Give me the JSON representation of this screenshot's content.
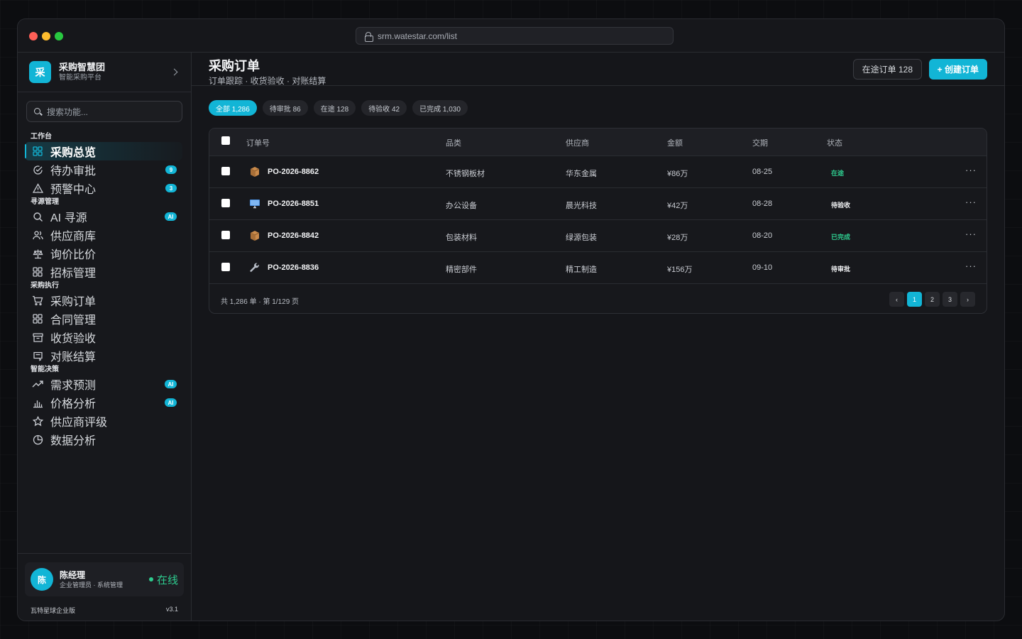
{
  "browser": {
    "url": "srm.watestar.com/list"
  },
  "brand": {
    "logo_char": "采",
    "name": "采购智慧团",
    "subtitle": "智能采购平台"
  },
  "search": {
    "placeholder": "搜索功能..."
  },
  "nav": {
    "groups": [
      {
        "label": "工作台",
        "items": [
          {
            "label": "采购总览",
            "icon": "grid-icon",
            "active": true
          },
          {
            "label": "待办审批",
            "icon": "check-circle-icon",
            "badge": "9"
          },
          {
            "label": "预警中心",
            "icon": "alert-triangle-icon",
            "badge": "3"
          }
        ]
      },
      {
        "label": "寻源管理",
        "items": [
          {
            "label": "AI 寻源",
            "icon": "search-icon",
            "badge": "AI"
          },
          {
            "label": "供应商库",
            "icon": "users-icon"
          },
          {
            "label": "询价比价",
            "icon": "scale-icon"
          },
          {
            "label": "招标管理",
            "icon": "grid-icon"
          }
        ]
      },
      {
        "label": "采购执行",
        "items": [
          {
            "label": "采购订单",
            "icon": "cart-icon"
          },
          {
            "label": "合同管理",
            "icon": "grid-icon"
          },
          {
            "label": "收货验收",
            "icon": "archive-icon"
          },
          {
            "label": "对账结算",
            "icon": "receipt-icon"
          }
        ]
      },
      {
        "label": "智能决策",
        "items": [
          {
            "label": "需求预测",
            "icon": "trending-up-icon",
            "badge": "AI"
          },
          {
            "label": "价格分析",
            "icon": "bar-chart-icon",
            "badge": "AI"
          },
          {
            "label": "供应商评级",
            "icon": "star-icon"
          },
          {
            "label": "数据分析",
            "icon": "pie-chart-icon"
          }
        ]
      }
    ]
  },
  "user": {
    "avatar_char": "陈",
    "name": "陈经理",
    "role": "企业管理员 · 系统管理",
    "status": "在线"
  },
  "footer": {
    "edition": "瓦特星球企业版",
    "version": "v3.1"
  },
  "page": {
    "title": "采购订单",
    "subtitle": "订单跟踪 · 收货验收 · 对账结算",
    "transit_button": "在途订单 128",
    "create_button": "+ 创建订单"
  },
  "tabs": [
    {
      "label": "全部 1,286",
      "active": true
    },
    {
      "label": "待审批 86"
    },
    {
      "label": "在途 128"
    },
    {
      "label": "待验收 42"
    },
    {
      "label": "已完成 1,030"
    }
  ],
  "table": {
    "columns": [
      "订单号",
      "品类",
      "供应商",
      "金额",
      "交期",
      "状态"
    ],
    "rows": [
      {
        "icon": "package-icon",
        "po": "PO-2026-8862",
        "category": "不锈钢板材",
        "supplier": "华东金属",
        "amount": "¥86万",
        "date": "08-25",
        "status": "在途",
        "status_color": "#2ecc8f"
      },
      {
        "icon": "monitor-icon",
        "po": "PO-2026-8851",
        "category": "办公设备",
        "supplier": "晨光科技",
        "amount": "¥42万",
        "date": "08-28",
        "status": "待验收",
        "status_color": "#f1f2f4"
      },
      {
        "icon": "package-icon",
        "po": "PO-2026-8842",
        "category": "包装材料",
        "supplier": "绿源包装",
        "amount": "¥28万",
        "date": "08-20",
        "status": "已完成",
        "status_color": "#2ecc8f"
      },
      {
        "icon": "wrench-icon",
        "po": "PO-2026-8836",
        "category": "精密部件",
        "supplier": "精工制造",
        "amount": "¥156万",
        "date": "09-10",
        "status": "待审批",
        "status_color": "#f1f2f4"
      }
    ],
    "summary": "共 1,286 单 · 第 1/129 页",
    "pager": [
      "‹",
      "1",
      "2",
      "3",
      "›"
    ],
    "current_page": "1",
    "more_glyph": "···"
  },
  "colors": {
    "accent": "#12b5d6",
    "success": "#2ecc8f",
    "background": "#15161a"
  }
}
